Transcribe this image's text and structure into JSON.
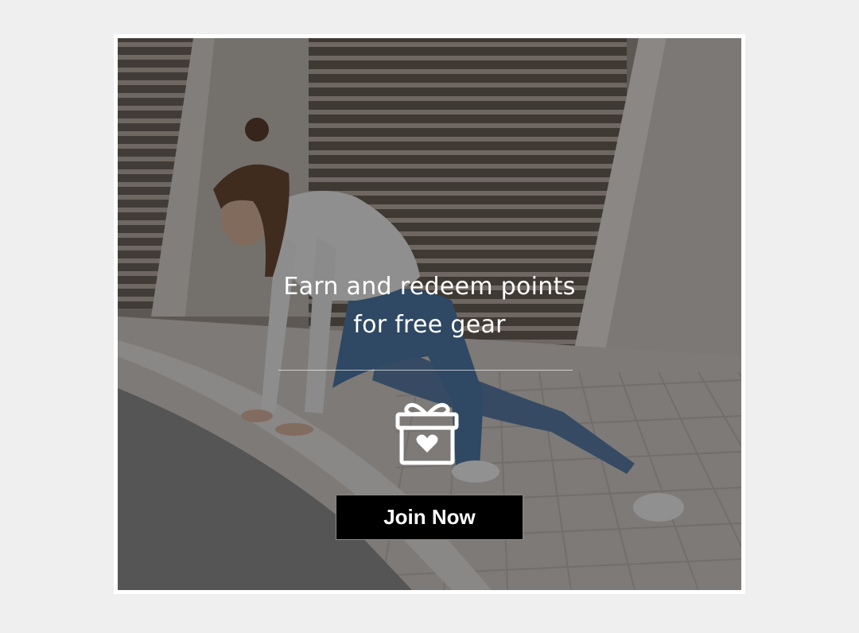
{
  "promo": {
    "headline_line1": "Earn and redeem points",
    "headline_line2": "for free gear",
    "cta_label": "Join Now",
    "icon": "gift-heart-icon"
  },
  "colors": {
    "page_background": "#efefef",
    "card_border": "#ffffff",
    "overlay": "rgba(0,0,0,0.40)",
    "text": "#ffffff",
    "button_background": "#000000"
  }
}
